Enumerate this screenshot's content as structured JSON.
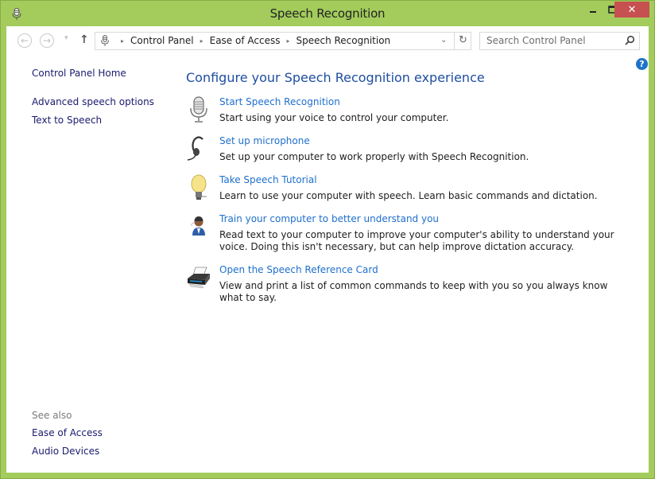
{
  "window": {
    "title": "Speech Recognition",
    "controls": {
      "minimize": "–",
      "maximize": "☐",
      "close": "✕"
    },
    "frame_color": "#a3cc5c",
    "close_color": "#c75050"
  },
  "nav": {
    "back": "←",
    "forward": "→",
    "recent": "▾",
    "up": "↑"
  },
  "address": {
    "breadcrumbs": [
      "Control Panel",
      "Ease of Access",
      "Speech Recognition"
    ],
    "separator": "▸",
    "dropdown": "⌄",
    "refresh": "↻"
  },
  "search": {
    "placeholder": "Search Control Panel"
  },
  "help": {
    "label": "?"
  },
  "sidebar": {
    "home": "Control Panel Home",
    "items": [
      {
        "label": "Advanced speech options"
      },
      {
        "label": "Text to Speech"
      }
    ],
    "see_also_label": "See also",
    "see_also": [
      {
        "label": "Ease of Access"
      },
      {
        "label": "Audio Devices"
      }
    ]
  },
  "main": {
    "heading": "Configure your Speech Recognition experience",
    "tasks": [
      {
        "icon": "microphone-icon",
        "link": "Start Speech Recognition",
        "desc": "Start using your voice to control your computer."
      },
      {
        "icon": "headset-icon",
        "link": "Set up microphone",
        "desc": "Set up your computer to work properly with Speech Recognition."
      },
      {
        "icon": "lightbulb-icon",
        "link": "Take Speech Tutorial",
        "desc": "Learn to use your computer with speech.  Learn basic commands and dictation."
      },
      {
        "icon": "user-headset-icon",
        "link": "Train your computer to better understand you",
        "desc": "Read text to your computer to improve your computer's ability to understand your voice.  Doing this isn't necessary, but can help improve dictation accuracy."
      },
      {
        "icon": "printer-icon",
        "link": "Open the Speech Reference Card",
        "desc": "View and print a list of common commands to keep with you so you always know what to say."
      }
    ]
  }
}
